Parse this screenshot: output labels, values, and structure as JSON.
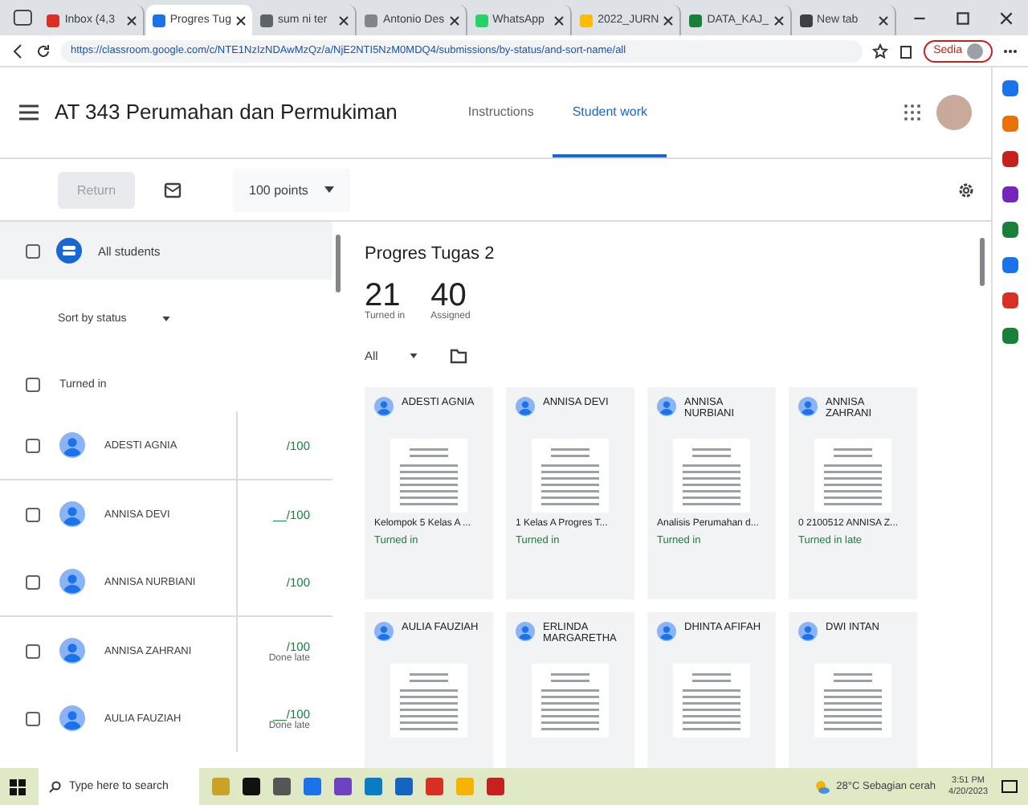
{
  "browser": {
    "tabs": [
      {
        "label": "Inbox (4,3",
        "selected": false,
        "color": "#d93025"
      },
      {
        "label": "Progres Tug",
        "selected": true,
        "color": "#1a73e8"
      },
      {
        "label": "sum ni ter",
        "selected": false,
        "color": "#5f6368"
      },
      {
        "label": "Antonio Des",
        "selected": false,
        "color": "#80868b"
      },
      {
        "label": "WhatsApp",
        "selected": false,
        "color": "#25d366"
      },
      {
        "label": "2022_JURN",
        "selected": false,
        "color": "#fbbc04"
      },
      {
        "label": "DATA_KAJ_",
        "selected": false,
        "color": "#188038"
      },
      {
        "label": "New tab",
        "selected": false,
        "color": "#3c4043"
      }
    ],
    "address": "https://classroom.google.com/c/NTE1NzIzNDAwMzQz/a/NjE2NTI5NzM0MDQ4/submissions/by-status/and-sort-name/all",
    "profile_button": "Sedia"
  },
  "header": {
    "title": "AT 343 Perumahan dan Permukiman",
    "tabs": [
      {
        "label": "Instructions",
        "selected": false
      },
      {
        "label": "Student work",
        "selected": true
      }
    ]
  },
  "toolbar": {
    "return_button": {
      "label": "Return",
      "disabled": true
    },
    "points": "100 points"
  },
  "student_list": {
    "all_students": {
      "label": "All students",
      "checked": false
    },
    "sort": "Sort by status",
    "group": {
      "label": "Turned in",
      "checked": false
    },
    "students": [
      {
        "name": "ADESTI AGNIA",
        "grade": "/100",
        "checked": false
      },
      {
        "name": "ANNISA DEVI",
        "grade": "__/100",
        "checked": false
      },
      {
        "name": "ANNISA NURBIANI",
        "grade": "/100",
        "checked": false
      },
      {
        "name": "ANNISA ZAHRANI",
        "grade": "/100",
        "note": "Done late",
        "checked": false
      },
      {
        "name": "AULIA FAUZIAH",
        "grade": "__/100",
        "note": "Done late",
        "checked": false
      }
    ]
  },
  "assignment": {
    "title": "Progres Tugas 2",
    "stats": [
      {
        "value": "21",
        "label": "Turned in"
      },
      {
        "value": "40",
        "label": "Assigned"
      }
    ],
    "filter": "All",
    "cards": [
      {
        "name": "ADESTI AGNIA",
        "file": "Kelompok 5 Kelas A ...",
        "status": "Turned in"
      },
      {
        "name": "ANNISA DEVI",
        "file": "1 Kelas A Progres T...",
        "status": "Turned in"
      },
      {
        "name": "ANNISA NURBIANI",
        "file": "Analisis Perumahan d...",
        "status": "Turned in"
      },
      {
        "name": "ANNISA ZAHRANI",
        "file": "0 2100512 ANNISA Z...",
        "status": "Turned in late"
      },
      {
        "name": "AULIA FAUZIAH"
      },
      {
        "name": "ERLINDA MARGARETHA"
      },
      {
        "name": "DHINTA AFIFAH"
      },
      {
        "name": "DWI INTAN"
      }
    ]
  },
  "taskbar": {
    "search_placeholder": "Type here to search",
    "weather": "28°C Sebagian cerah",
    "time": "3:51 PM",
    "date": "4/20/2023"
  }
}
